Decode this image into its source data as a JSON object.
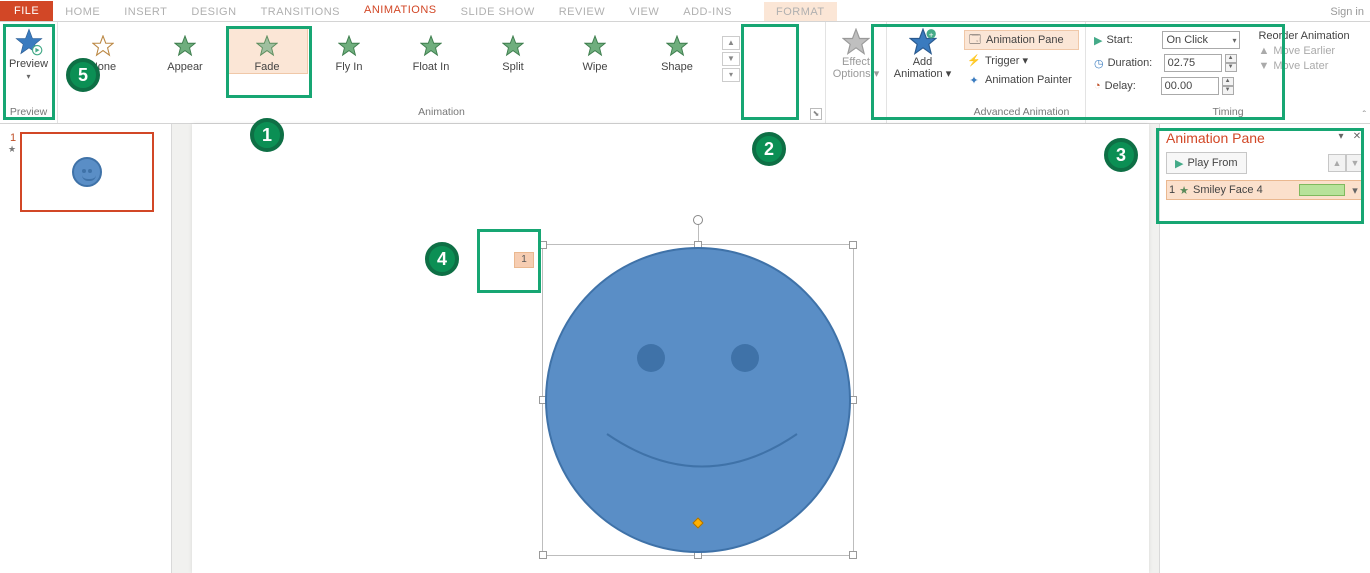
{
  "tabs": {
    "file": "FILE",
    "items": [
      "HOME",
      "INSERT",
      "DESIGN",
      "TRANSITIONS",
      "ANIMATIONS",
      "SLIDE SHOW",
      "REVIEW",
      "VIEW",
      "ADD-INS"
    ],
    "format": "FORMAT",
    "active_index": 4,
    "sign_in": "Sign in"
  },
  "ribbon": {
    "preview": {
      "label": "Preview",
      "group": "Preview"
    },
    "gallery": {
      "items": [
        "None",
        "Appear",
        "Fade",
        "Fly In",
        "Float In",
        "Split",
        "Wipe",
        "Shape"
      ],
      "selected_index": 2,
      "group": "Animation"
    },
    "effect": {
      "line1": "Effect",
      "line2": "Options"
    },
    "add": {
      "line1": "Add",
      "line2": "Animation"
    },
    "advanced": {
      "pane": "Animation Pane",
      "trigger": "Trigger",
      "painter": "Animation Painter",
      "group": "Advanced Animation"
    },
    "timing": {
      "start_label": "Start:",
      "start_value": "On Click",
      "duration_label": "Duration:",
      "duration_value": "02.75",
      "delay_label": "Delay:",
      "delay_value": "00.00",
      "reorder": "Reorder Animation",
      "earlier": "Move Earlier",
      "later": "Move Later",
      "group": "Timing"
    }
  },
  "thumb": {
    "number": "1"
  },
  "slide": {
    "anim_tag": "1"
  },
  "anim_pane": {
    "title": "Animation Pane",
    "play": "Play From",
    "item_index": "1",
    "item_name": "Smiley Face 4"
  },
  "callouts": {
    "c1": "1",
    "c2": "2",
    "c3": "3",
    "c4": "4",
    "c5": "5"
  }
}
